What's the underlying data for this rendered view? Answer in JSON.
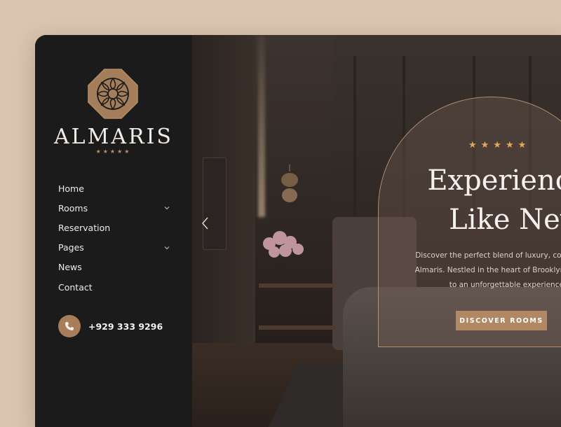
{
  "brand": {
    "name": "ALMARIS",
    "stars": "★★★★★",
    "logo_icon": "ornament-icon",
    "accent_color": "#a87e5a"
  },
  "nav": {
    "items": [
      {
        "label": "Home",
        "has_dropdown": false
      },
      {
        "label": "Rooms",
        "has_dropdown": true
      },
      {
        "label": "Reservation",
        "has_dropdown": false
      },
      {
        "label": "Pages",
        "has_dropdown": true
      },
      {
        "label": "News",
        "has_dropdown": false
      },
      {
        "label": "Contact",
        "has_dropdown": false
      }
    ]
  },
  "contact": {
    "phone": "+929 333 9296",
    "icon": "phone-icon"
  },
  "hero": {
    "stars": "★★★★★",
    "headline_line1": "Experience Hos",
    "headline_line2": "Like Never Be",
    "description_line1": "Discover the perfect blend of luxury, comfort, and",
    "description_line2": "Almaris. Nestled in the heart of Brooklyn, our hote",
    "description_line3": "to an unforgettable experience.",
    "cta_label": "DISCOVER ROOMS",
    "cta_color": "#b08863",
    "star_color": "#e4a85a"
  }
}
